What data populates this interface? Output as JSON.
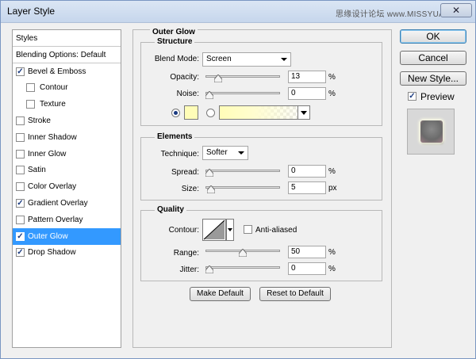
{
  "window": {
    "title": "Layer Style",
    "watermark": "思缘设计论坛 www.MISSYUAN.COM",
    "close_glyph": "✕"
  },
  "style_list": {
    "items": [
      {
        "label": "Styles",
        "checkbox": false,
        "checked": false,
        "indent": false,
        "active": false
      },
      {
        "label": "Blending Options: Default",
        "checkbox": false,
        "checked": false,
        "indent": false,
        "active": false
      },
      {
        "label": "Bevel & Emboss",
        "checkbox": true,
        "checked": true,
        "indent": false,
        "active": false
      },
      {
        "label": "Contour",
        "checkbox": true,
        "checked": false,
        "indent": true,
        "active": false
      },
      {
        "label": "Texture",
        "checkbox": true,
        "checked": false,
        "indent": true,
        "active": false
      },
      {
        "label": "Stroke",
        "checkbox": true,
        "checked": false,
        "indent": false,
        "active": false
      },
      {
        "label": "Inner Shadow",
        "checkbox": true,
        "checked": false,
        "indent": false,
        "active": false
      },
      {
        "label": "Inner Glow",
        "checkbox": true,
        "checked": false,
        "indent": false,
        "active": false
      },
      {
        "label": "Satin",
        "checkbox": true,
        "checked": false,
        "indent": false,
        "active": false
      },
      {
        "label": "Color Overlay",
        "checkbox": true,
        "checked": false,
        "indent": false,
        "active": false
      },
      {
        "label": "Gradient Overlay",
        "checkbox": true,
        "checked": true,
        "indent": false,
        "active": false
      },
      {
        "label": "Pattern Overlay",
        "checkbox": true,
        "checked": false,
        "indent": false,
        "active": false
      },
      {
        "label": "Outer Glow",
        "checkbox": true,
        "checked": true,
        "indent": false,
        "active": true
      },
      {
        "label": "Drop Shadow",
        "checkbox": true,
        "checked": true,
        "indent": false,
        "active": false
      }
    ]
  },
  "outer_glow": {
    "title": "Outer Glow",
    "structure": {
      "label": "Structure",
      "blend_mode_label": "Blend Mode:",
      "blend_mode_value": "Screen",
      "opacity_label": "Opacity:",
      "opacity_value": "13",
      "opacity_level": 13,
      "opacity_unit": "%",
      "noise_label": "Noise:",
      "noise_value": "0",
      "noise_level": 0,
      "noise_unit": "%",
      "glow_color": "#fffdb8"
    },
    "elements": {
      "label": "Elements",
      "technique_label": "Technique:",
      "technique_value": "Softer",
      "spread_label": "Spread:",
      "spread_value": "0",
      "spread_level": 0,
      "spread_unit": "%",
      "size_label": "Size:",
      "size_value": "5",
      "size_level": 2,
      "size_unit": "px"
    },
    "quality": {
      "label": "Quality",
      "contour_label": "Contour:",
      "anti_aliased_label": "Anti-aliased",
      "range_label": "Range:",
      "range_value": "50",
      "range_level": 50,
      "range_unit": "%",
      "jitter_label": "Jitter:",
      "jitter_value": "0",
      "jitter_level": 0,
      "jitter_unit": "%"
    },
    "make_default_label": "Make Default",
    "reset_default_label": "Reset to Default"
  },
  "right": {
    "ok_label": "OK",
    "cancel_label": "Cancel",
    "new_style_label": "New Style...",
    "preview_label": "Preview",
    "preview_checked": true
  },
  "colors": {
    "selection": "#3399ff",
    "glow": "#fffdb8"
  }
}
